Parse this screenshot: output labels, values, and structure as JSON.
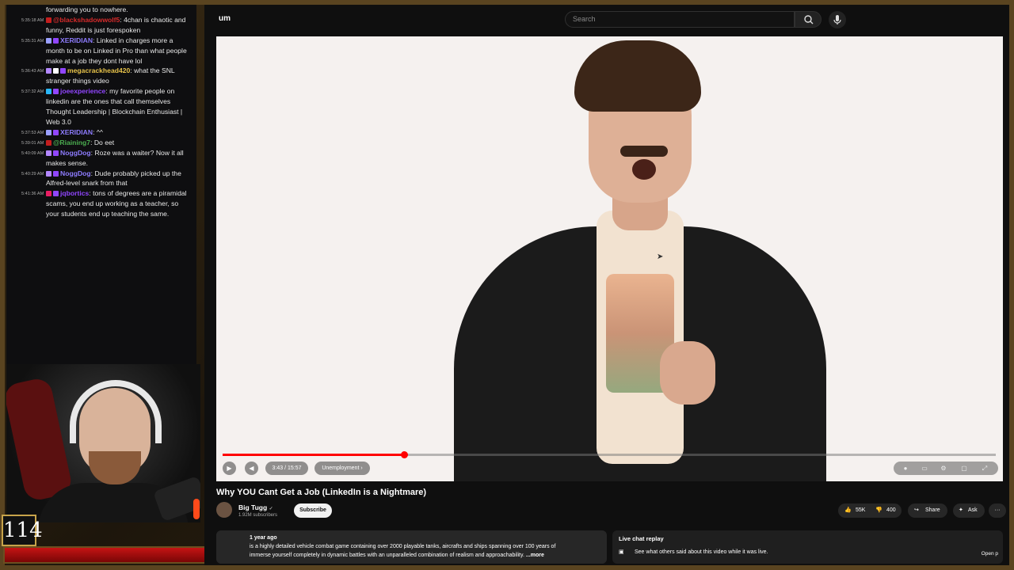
{
  "chat": {
    "messages": [
      {
        "time": "",
        "user": "",
        "user_color": "#ffffff",
        "badges": [],
        "text": "forwarding you to nowhere."
      },
      {
        "time": "5:35:18 AM",
        "user": "@blackshadowwolf5",
        "user_color": "#d62b2b",
        "badges": [
          "#c41e1e"
        ],
        "text": ": 4chan is chaotic and funny, Reddit is just forespoken"
      },
      {
        "time": "5:35:31 AM",
        "user": "XERIDIAN",
        "user_color": "#8e7cff",
        "badges": [
          "#9aa0ff",
          "#9146ff"
        ],
        "text": ": Linked in charges more a month to be on Linked in Pro than what people make at a job they dont have lol"
      },
      {
        "time": "5:36:43 AM",
        "user": "megacrackhead420",
        "user_color": "#e6c24a",
        "badges": [
          "#b388ff",
          "#ffffff",
          "#9146ff"
        ],
        "text": ": what the SNL stranger things video"
      },
      {
        "time": "5:37:32 AM",
        "user": "joeexperience",
        "user_color": "#9146ff",
        "badges": [
          "#29b6f6",
          "#9146ff"
        ],
        "text": ": my favorite people on linkedin are the ones that call themselves Thought Leadership | Blockchain Enthusiast | Web 3.0"
      },
      {
        "time": "5:37:53 AM",
        "user": "XERIDIAN",
        "user_color": "#8e7cff",
        "badges": [
          "#9aa0ff",
          "#9146ff"
        ],
        "text": ": ^^"
      },
      {
        "time": "5:39:01 AM",
        "user": "@Riaining7",
        "user_color": "#4caf50",
        "badges": [
          "#c41e1e"
        ],
        "text": ": Do eet"
      },
      {
        "time": "5:40:09 AM",
        "user": "NoggDog",
        "user_color": "#8e7cff",
        "badges": [
          "#b388ff",
          "#9146ff"
        ],
        "text": ": Roze was a waiter? Now it all makes sense."
      },
      {
        "time": "5:40:29 AM",
        "user": "NoggDog",
        "user_color": "#8e7cff",
        "badges": [
          "#b388ff",
          "#9146ff"
        ],
        "text": ": Dude probably picked up the Alfred-level snark from that"
      },
      {
        "time": "5:41:36 AM",
        "user": "jqbortics",
        "user_color": "#9146ff",
        "badges": [
          "#e91e63",
          "#9146ff"
        ],
        "text": ": tons of degrees are a piramidal scams, you end up working as a teacher, so your students end up teaching the same."
      }
    ]
  },
  "stream": {
    "counter": "114"
  },
  "youtube": {
    "logo_text": "um",
    "search_placeholder": "Search",
    "video": {
      "title": "Why YOU Cant Get a Job (LinkedIn is a Nightmare)",
      "time": "3:43 / 15:57",
      "chapter": "Unemployment ›",
      "progress": 0.235,
      "buffered": 0.33
    },
    "channel": {
      "name": "Big Tugg",
      "verified": "✓",
      "subscribers": "1.92M subscribers",
      "subscribe_label": "Subscribe"
    },
    "actions": {
      "likes": "55K",
      "dislikes": "400",
      "share": "Share",
      "ask": "Ask",
      "more": "···"
    },
    "description": {
      "date": "1 year ago",
      "line1": "is a highly detailed vehicle combat game containing over 2000 playable tanks, aircrafts and ships spanning over 100 years of",
      "line2": "immerse yourself completely in dynamic battles with an unparalleled combination of realism and approachability.",
      "more": "...more"
    },
    "live_chat": {
      "title": "Live chat replay",
      "text": "See what others said about this video while it was live.",
      "open": "Open p"
    },
    "colors": {
      "accent": "#ff0000",
      "bg": "#0f0f0f"
    }
  }
}
